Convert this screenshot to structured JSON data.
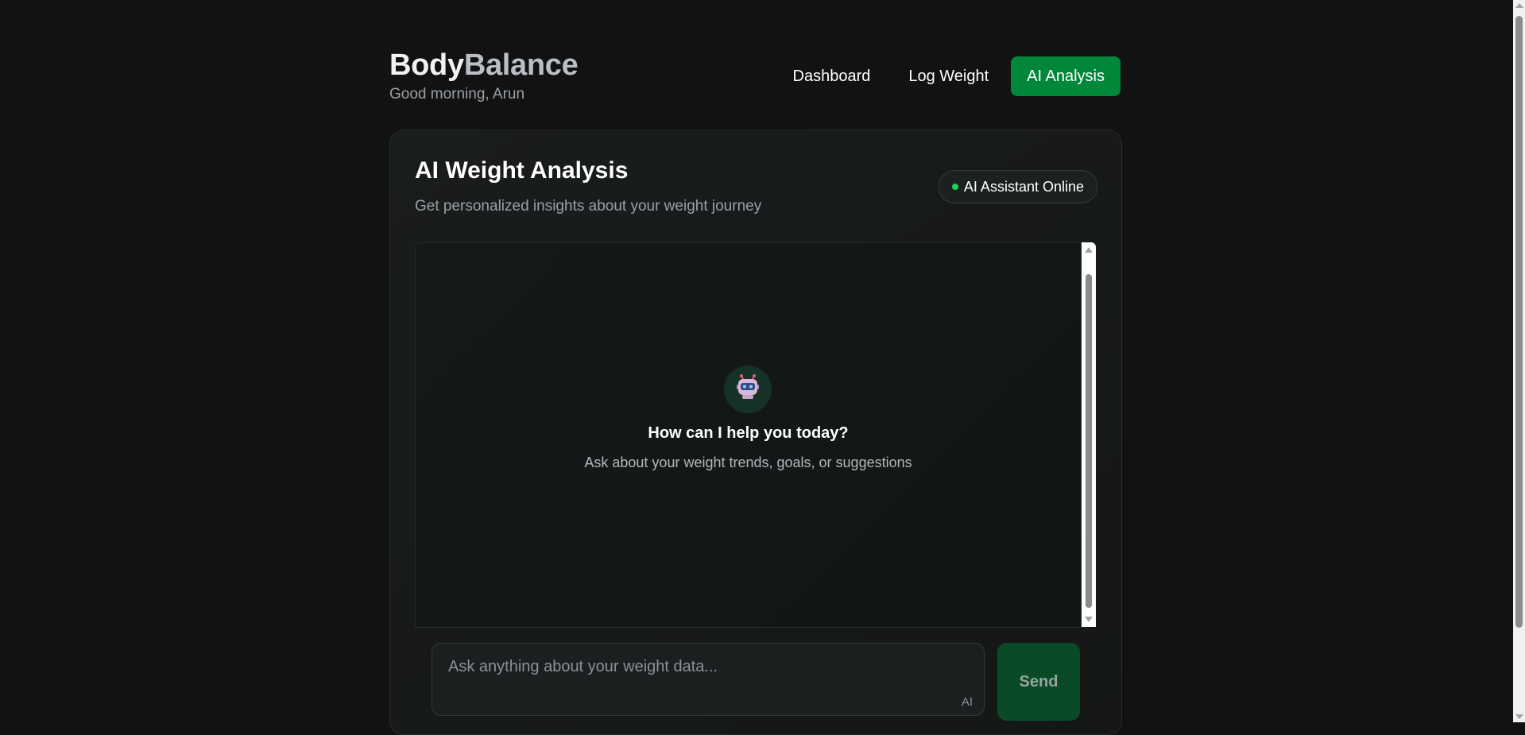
{
  "header": {
    "brand_part1": "Body",
    "brand_part2": "Balance",
    "greeting": "Good morning, Arun"
  },
  "nav": {
    "items": [
      {
        "label": "Dashboard",
        "active": false
      },
      {
        "label": "Log Weight",
        "active": false
      },
      {
        "label": "AI Analysis",
        "active": true
      }
    ]
  },
  "card": {
    "title": "AI Weight Analysis",
    "subtitle": "Get personalized insights about your weight journey",
    "status": "AI Assistant Online"
  },
  "empty_state": {
    "icon": "robot-icon",
    "title": "How can I help you today?",
    "subtitle": "Ask about your weight trends, goals, or suggestions"
  },
  "composer": {
    "placeholder": "Ask anything about your weight data...",
    "value": "",
    "tag": "AI",
    "send_label": "Send"
  },
  "colors": {
    "background": "#121212",
    "accent": "#00873a",
    "status_dot": "#19d35f",
    "send_button": "#0a4a26"
  }
}
